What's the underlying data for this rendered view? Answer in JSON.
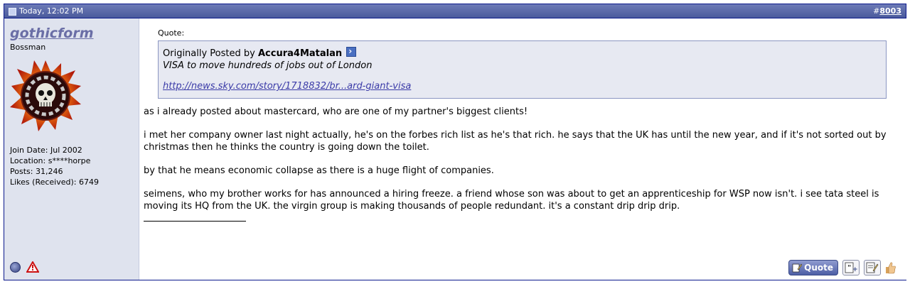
{
  "header": {
    "datetime": "Today, 12:02 PM",
    "post_number_prefix": "#",
    "post_number": "8003"
  },
  "user": {
    "name": "gothicform",
    "title": "Bossman",
    "info": [
      "Join Date: Jul 2002",
      "Location: s****horpe",
      "Posts: 31,246",
      "Likes (Received): 6749"
    ]
  },
  "quote": {
    "label": "Quote:",
    "originally_posted_by": "Originally Posted by",
    "author": "Accura4Matalan",
    "text": "VISA to move hundreds of jobs out of London",
    "link": "http://news.sky.com/story/1718832/br...ard-giant-visa"
  },
  "message": [
    "as i already posted about mastercard, who are one of my partner's biggest clients!",
    "i met her company owner last night actually, he's on the forbes rich list as he's that rich. he says that the UK has until the new year, and if it's not sorted out by christmas then he thinks the country is going down the toilet.",
    "by that he means economic collapse as there is a huge flight of companies.",
    "seimens, who my brother works for has announced a hiring freeze. a friend whose son was about to get an apprenticeship for WSP now isn't. i see tata steel is moving its HQ from the UK. the virgin group is making thousands of people redundant. it's a constant drip drip drip."
  ],
  "buttons": {
    "quote_label": "Quote"
  },
  "colors": {
    "header_bg": "#5060a4",
    "sidebar_bg": "#dfe3ee",
    "username": "#6a6ea6",
    "quote_bg": "#e7e9f2"
  }
}
